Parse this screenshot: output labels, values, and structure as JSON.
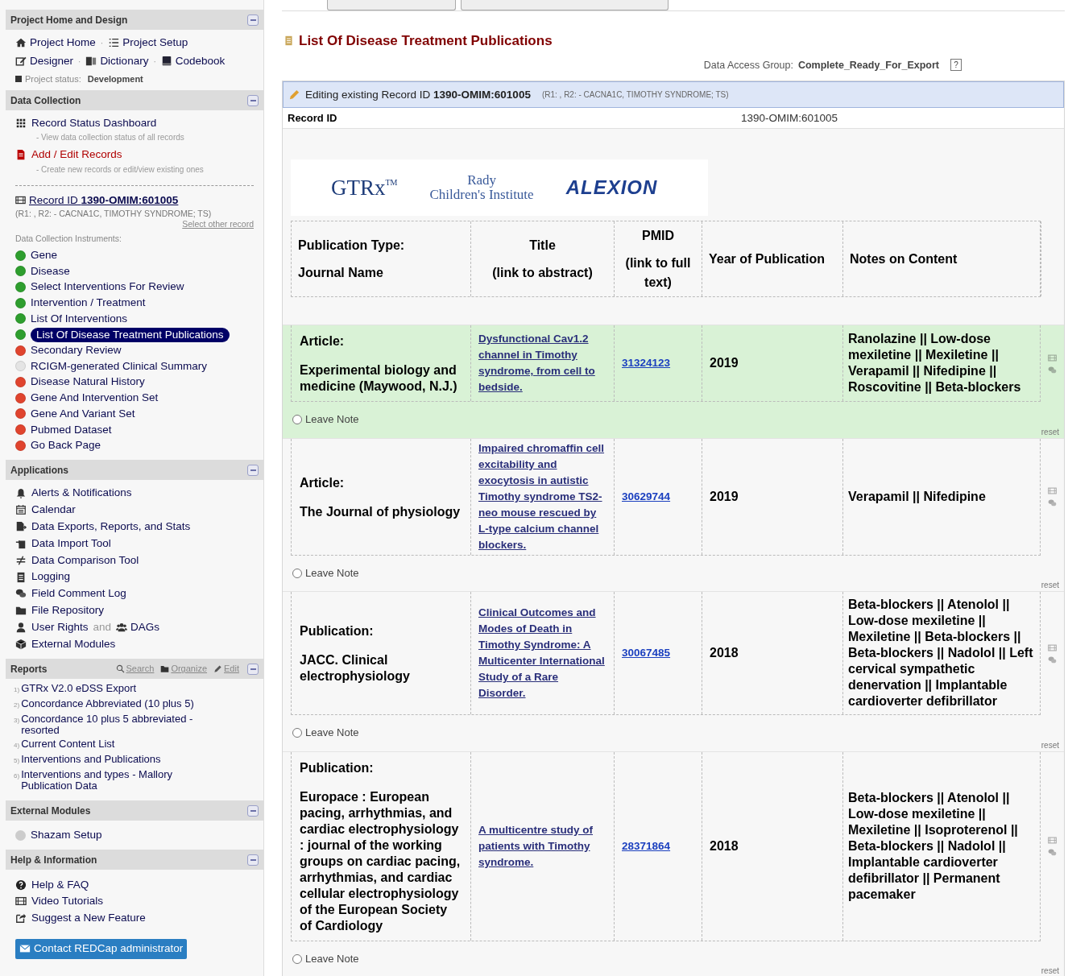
{
  "sidebar": {
    "project": {
      "title": "Project Home and Design",
      "link_rows": [
        [
          {
            "label": "Project Home"
          },
          {
            "separator": "·",
            "label": "Project Setup"
          }
        ],
        [
          {
            "label": "Designer"
          },
          {
            "separator": "·",
            "label": "Dictionary"
          },
          {
            "separator": "·",
            "label": "Codebook"
          }
        ]
      ],
      "status_label": "Project status:",
      "status_value": "Development"
    },
    "data_collection": {
      "title": "Data Collection",
      "links": [
        {
          "label": "Record Status Dashboard",
          "note": "- View data collection status of all records",
          "kind": "normal"
        },
        {
          "label": "Add / Edit Records",
          "note": "- Create new records or edit/view existing ones",
          "kind": "alert"
        }
      ],
      "record": {
        "prefix": "Record ID",
        "id": "1390-OMIM:601005",
        "detail": "(R1: , R2: - CACNA1C, TIMOTHY SYNDROME; TS)",
        "select_other": "Select other record"
      },
      "instruments_label": "Data Collection Instruments:",
      "instruments": [
        {
          "label": "Gene",
          "color": "#2e9e2e",
          "selected": false
        },
        {
          "label": "Disease",
          "color": "#2e9e2e",
          "selected": false
        },
        {
          "label": "Select Interventions For Review",
          "color": "#2e9e2e",
          "selected": false
        },
        {
          "label": "Intervention / Treatment",
          "color": "#2e9e2e",
          "selected": false
        },
        {
          "label": "List Of Interventions",
          "color": "#2e9e2e",
          "selected": false
        },
        {
          "label": "List Of Disease Treatment Publications",
          "color": "#2e9e2e",
          "selected": true
        },
        {
          "label": "Secondary Review",
          "color": "#e0442e",
          "selected": false
        },
        {
          "label": "RCIGM-generated Clinical Summary",
          "color": "#e4e4e4",
          "selected": false
        },
        {
          "label": "Disease Natural History",
          "color": "#e0442e",
          "selected": false
        },
        {
          "label": "Gene And Intervention Set",
          "color": "#e0442e",
          "selected": false
        },
        {
          "label": "Gene And Variant Set",
          "color": "#e0442e",
          "selected": false
        },
        {
          "label": "Pubmed Dataset",
          "color": "#e0442e",
          "selected": false
        },
        {
          "label": "Go Back Page",
          "color": "#e0442e",
          "selected": false
        }
      ]
    },
    "applications": {
      "title": "Applications",
      "items": [
        {
          "label": "Alerts & Notifications"
        },
        {
          "label": "Calendar"
        },
        {
          "label": "Data Exports, Reports, and Stats"
        },
        {
          "label": "Data Import Tool"
        },
        {
          "label": "Data Comparison Tool"
        },
        {
          "label": "Logging"
        },
        {
          "label": "Field Comment Log"
        },
        {
          "label": "File Repository"
        },
        {
          "label": "User Rights",
          "joiner": "and",
          "label2": "DAGs"
        },
        {
          "label": "External Modules"
        }
      ]
    },
    "reports": {
      "title": "Reports",
      "actions": [
        {
          "label": "Search"
        },
        {
          "label": "Organize"
        },
        {
          "label": "Edit"
        }
      ],
      "items": [
        {
          "number": "1)",
          "label": "GTRx V2.0 eDSS Export"
        },
        {
          "number": "2)",
          "label": "Concordance Abbreviated (10 plus 5)"
        },
        {
          "number": "3)",
          "label": "Concordance 10 plus 5 abbreviated - resorted"
        },
        {
          "number": "4)",
          "label": "Current Content List"
        },
        {
          "number": "5)",
          "label": "Interventions and Publications"
        },
        {
          "number": "6)",
          "label": "Interventions and types - Mallory Publication Data"
        }
      ]
    },
    "external_modules": {
      "title": "External Modules",
      "items": [
        {
          "label": "Shazam Setup"
        }
      ]
    },
    "help": {
      "title": "Help & Information",
      "items": [
        {
          "label": "Help & FAQ"
        },
        {
          "label": "Video Tutorials"
        },
        {
          "label": "Suggest a New Feature"
        }
      ],
      "contact_button": "Contact REDCap administrator"
    }
  },
  "main": {
    "form_title": "List Of Disease Treatment Publications",
    "dag": {
      "label": "Data Access Group:",
      "value": "Complete_Ready_For_Export",
      "help": "?"
    },
    "editing": {
      "prefix": "Editing existing Record ID",
      "id": "1390-OMIM:601005",
      "detail": "(R1: , R2: - CACNA1C, TIMOTHY SYNDROME; TS)"
    },
    "record_id": {
      "label": "Record ID",
      "value": "1390-OMIM:601005"
    },
    "logos": {
      "gtrx": "GTRx",
      "tm": "TM",
      "rady_1": "Rady",
      "rady_2": "Children's Institute",
      "alexion": "ALEXION"
    },
    "columns": [
      {
        "lines": [
          "Publication Type:",
          "Journal Name"
        ]
      },
      {
        "lines": [
          "Title",
          "(link to abstract)"
        ]
      },
      {
        "lines": [
          "PMID",
          "(link to full text)"
        ]
      },
      {
        "lines": [
          "Year of Publication"
        ]
      },
      {
        "lines": [
          "Notes on Content"
        ]
      }
    ],
    "rows": [
      {
        "type": "Article:",
        "journal": "Experimental biology and medicine (Maywood, N.J.)",
        "title": "Dysfunctional Cav1.2 channel in Timothy syndrome, from cell to bedside.",
        "pmid": "31324123",
        "year": "2019",
        "notes": "Ranolazine || Low-dose mexiletine || Mexiletine || Verapamil || Nifedipine || Roscovitine || Beta-blockers",
        "highlighted": true,
        "note_label": "Leave Note",
        "note_checked": false,
        "reset": "reset"
      },
      {
        "type": "Article:",
        "journal": "The Journal of physiology",
        "title": "Impaired chromaffin cell excitability and exocytosis in autistic Timothy syndrome TS2-neo mouse rescued by L-type calcium channel blockers.",
        "pmid": "30629744",
        "year": "2019",
        "notes": "Verapamil || Nifedipine",
        "highlighted": false,
        "note_label": "Leave Note",
        "note_checked": false,
        "reset": "reset"
      },
      {
        "type": "Publication:",
        "journal": "JACC. Clinical electrophysiology",
        "title": "Clinical Outcomes and Modes of Death in Timothy Syndrome: A Multicenter International Study of a Rare Disorder.",
        "pmid": "30067485",
        "year": "2018",
        "notes": "Beta-blockers || Atenolol || Low-dose mexiletine || Mexiletine || Beta-blockers || Beta-blockers || Nadolol || Left cervical sympathetic denervation || Implantable cardioverter defibrillator",
        "highlighted": false,
        "note_label": "Leave Note",
        "note_checked": false,
        "reset": "reset"
      },
      {
        "type": "Publication:",
        "journal": "Europace : European pacing, arrhythmias, and cardiac electrophysiology : journal of the working groups on cardiac pacing, arrhythmias, and cardiac cellular electrophysiology of the European Society of Cardiology",
        "title": "A multicentre study of patients with Timothy syndrome.",
        "pmid": "28371864",
        "year": "2018",
        "notes": "Beta-blockers || Atenolol || Low-dose mexiletine || Mexiletine || Isoproterenol || Beta-blockers || Nadolol || Implantable cardioverter defibrillator || Permanent pacemaker",
        "highlighted": false,
        "note_label": "Leave Note",
        "note_checked": false,
        "reset": "reset"
      }
    ]
  }
}
